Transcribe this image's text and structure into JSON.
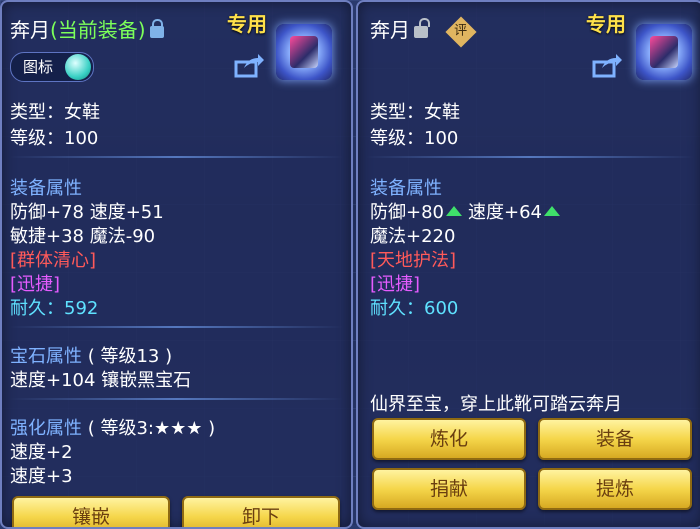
{
  "left": {
    "name": "奔月",
    "current_tag": "(当前装备)",
    "special": "专用",
    "toggle_label": "图标",
    "type": "类型：女鞋",
    "level": "等级：100",
    "equip_header": "装备属性",
    "stat_line1": "防御+78 速度+51",
    "stat_line2": "敏捷+38 魔法-90",
    "skill1": "[群体清心]",
    "skill2": "[迅捷]",
    "durability": "耐久：592",
    "gem_header": "宝石属性",
    "gem_level": "( 等级13 )",
    "gem_line": "速度+104 镶嵌黑宝石",
    "enhance_header": "强化属性",
    "enhance_level": "( 等级3:★★★ )",
    "enhance1": "速度+2",
    "enhance2": "速度+3",
    "btn_inlay": "镶嵌",
    "btn_unequip": "卸下"
  },
  "right": {
    "name": "奔月",
    "eval": "评",
    "special": "专用",
    "type": "类型：女鞋",
    "level": "等级：100",
    "equip_header": "装备属性",
    "def": "防御+80",
    "spd": "速度+64",
    "magic": "魔法+220",
    "skill1": "[天地护法]",
    "skill2": "[迅捷]",
    "durability": "耐久：600",
    "desc": "仙界至宝，穿上此靴可踏云奔月",
    "btn_refine": "炼化",
    "btn_equip": "装备",
    "btn_donate": "捐献",
    "btn_extract": "提炼"
  },
  "colors": {
    "header": "#7fb2ff",
    "special": "#ffe14a",
    "current": "#7cff5a",
    "red_skill": "#ff5a5a",
    "purple_skill": "#e55cff",
    "durability": "#5fe2ff",
    "up_arrow": "#3fe06a"
  }
}
